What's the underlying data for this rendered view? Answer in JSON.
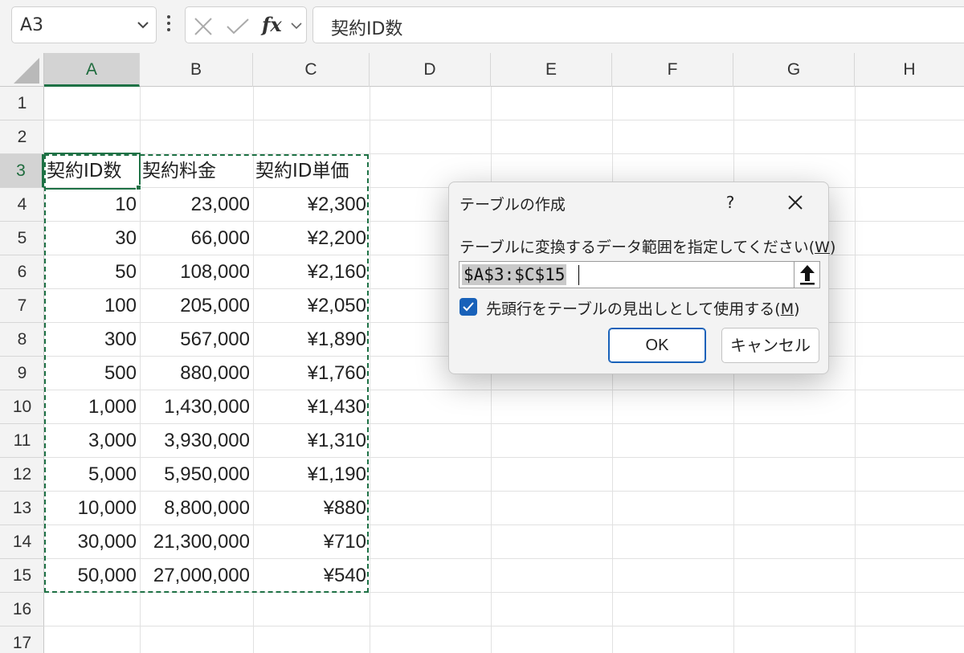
{
  "formula_bar": {
    "name_box": "A3",
    "fx": "fx",
    "formula": "契約ID数"
  },
  "columns": [
    "A",
    "B",
    "C",
    "D",
    "E",
    "F",
    "G",
    "H"
  ],
  "rows": [
    "1",
    "2",
    "3",
    "4",
    "5",
    "6",
    "7",
    "8",
    "9",
    "10",
    "11",
    "12",
    "13",
    "14",
    "15",
    "16",
    "17"
  ],
  "table": {
    "headers": [
      "契約ID数",
      "契約料金",
      "契約ID単価"
    ],
    "rows": [
      [
        "10",
        "23,000",
        "¥2,300"
      ],
      [
        "30",
        "66,000",
        "¥2,200"
      ],
      [
        "50",
        "108,000",
        "¥2,160"
      ],
      [
        "100",
        "205,000",
        "¥2,050"
      ],
      [
        "300",
        "567,000",
        "¥1,890"
      ],
      [
        "500",
        "880,000",
        "¥1,760"
      ],
      [
        "1,000",
        "1,430,000",
        "¥1,430"
      ],
      [
        "3,000",
        "3,930,000",
        "¥1,310"
      ],
      [
        "5,000",
        "5,950,000",
        "¥1,190"
      ],
      [
        "10,000",
        "8,800,000",
        "¥880"
      ],
      [
        "30,000",
        "21,300,000",
        "¥710"
      ],
      [
        "50,000",
        "27,000,000",
        "¥540"
      ]
    ]
  },
  "dialog": {
    "title": "テーブルの作成",
    "help": "?",
    "prompt_text": "テーブルに変換するデータ範囲を指定してください(",
    "prompt_key": "W",
    "prompt_end": ")",
    "range": "$A$3:$C$15",
    "checkbox_text": "先頭行をテーブルの見出しとして使用する(",
    "checkbox_key": "M",
    "checkbox_end": ")",
    "checkbox_checked": true,
    "ok": "OK",
    "cancel": "キャンセル"
  },
  "colors": {
    "selection_green": "#1e7145",
    "accent_blue": "#1861b9"
  }
}
